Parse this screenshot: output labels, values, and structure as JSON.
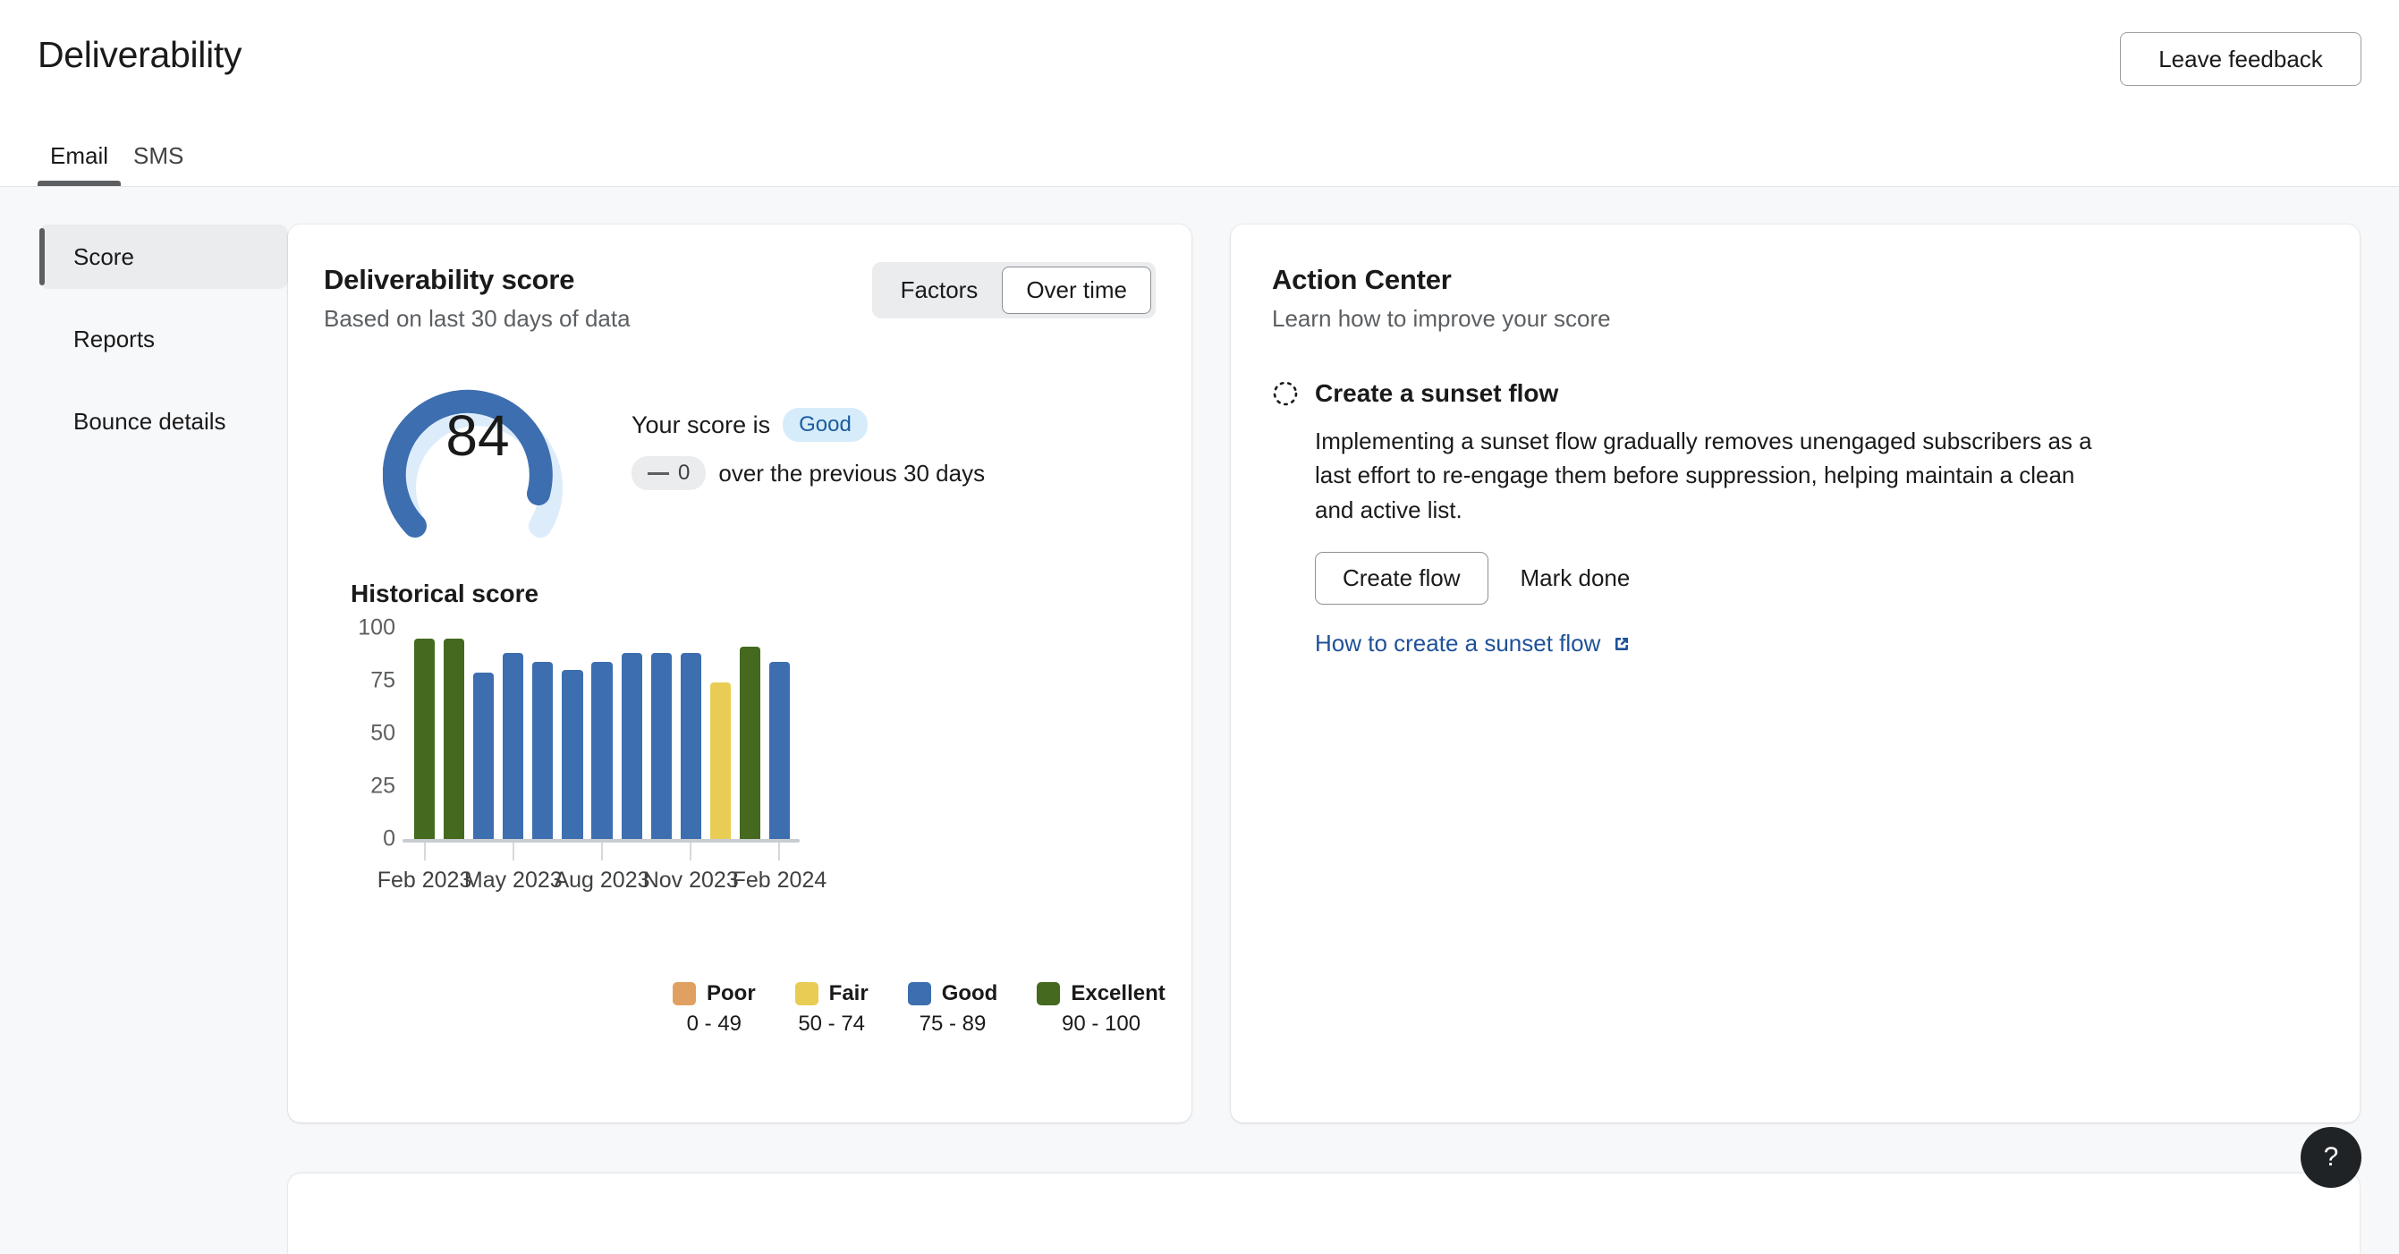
{
  "header": {
    "title": "Deliverability",
    "feedback_button": "Leave feedback",
    "tabs": [
      {
        "label": "Email",
        "active": true
      },
      {
        "label": "SMS",
        "active": false
      }
    ]
  },
  "sidebar": {
    "items": [
      {
        "label": "Score",
        "active": true
      },
      {
        "label": "Reports",
        "active": false
      },
      {
        "label": "Bounce details",
        "active": false
      }
    ]
  },
  "score_card": {
    "title": "Deliverability score",
    "subtitle": "Based on last 30 days of data",
    "segmented": [
      {
        "label": "Factors",
        "active": false
      },
      {
        "label": "Over time",
        "active": true
      }
    ],
    "gauge": {
      "value": "84",
      "value_number": 84,
      "max": 100,
      "arc_color": "#3d6eb0",
      "track_color": "#dcecfa"
    },
    "score_text_prefix": "Your score is",
    "score_rating": "Good",
    "delta_dash": "—",
    "delta_value": "0",
    "delta_suffix": "over the previous 30 days",
    "chart_title": "Historical score"
  },
  "chart_data": {
    "type": "bar",
    "title": "Historical score",
    "xlabel": "",
    "ylabel": "",
    "ylim": [
      0,
      100
    ],
    "yticks": [
      100,
      75,
      50,
      25,
      0
    ],
    "grid": false,
    "legend_position": "bottom",
    "categories": [
      "Feb 2023",
      "Mar 2023",
      "Apr 2023",
      "May 2023",
      "Jun 2023",
      "Jul 2023",
      "Aug 2023",
      "Sep 2023",
      "Oct 2023",
      "Nov 2023",
      "Dec 2023",
      "Jan 2024",
      "Feb 2024"
    ],
    "xtick_labels": [
      "Feb 2023",
      "May 2023",
      "Aug 2023",
      "Nov 2023",
      "Feb 2024"
    ],
    "xtick_indices": [
      0,
      3,
      6,
      9,
      12
    ],
    "values": [
      95,
      95,
      79,
      88,
      84,
      80,
      84,
      88,
      88,
      88,
      74,
      91,
      84
    ],
    "bar_colors": [
      "#44691f",
      "#44691f",
      "#3d6eb0",
      "#3d6eb0",
      "#3d6eb0",
      "#3d6eb0",
      "#3d6eb0",
      "#3d6eb0",
      "#3d6eb0",
      "#3d6eb0",
      "#e9cc54",
      "#44691f",
      "#3d6eb0"
    ],
    "legend": [
      {
        "label": "Poor",
        "range": "0 - 49",
        "color": "#e0a061"
      },
      {
        "label": "Fair",
        "range": "50 - 74",
        "color": "#e9cc54"
      },
      {
        "label": "Good",
        "range": "75 - 89",
        "color": "#3d6eb0"
      },
      {
        "label": "Excellent",
        "range": "90 - 100",
        "color": "#44691f"
      }
    ]
  },
  "action_center": {
    "title": "Action Center",
    "subtitle": "Learn how to improve your score",
    "items": [
      {
        "icon": "dotted-circle-icon",
        "title": "Create a sunset flow",
        "body": "Implementing a sunset flow gradually removes unengaged subscribers as a last effort to re-engage them before suppression, helping maintain a clean and active list.",
        "primary_button": "Create flow",
        "secondary_button": "Mark done",
        "link_text": "How to create a sunset flow"
      }
    ]
  },
  "help": {
    "label": "?"
  }
}
